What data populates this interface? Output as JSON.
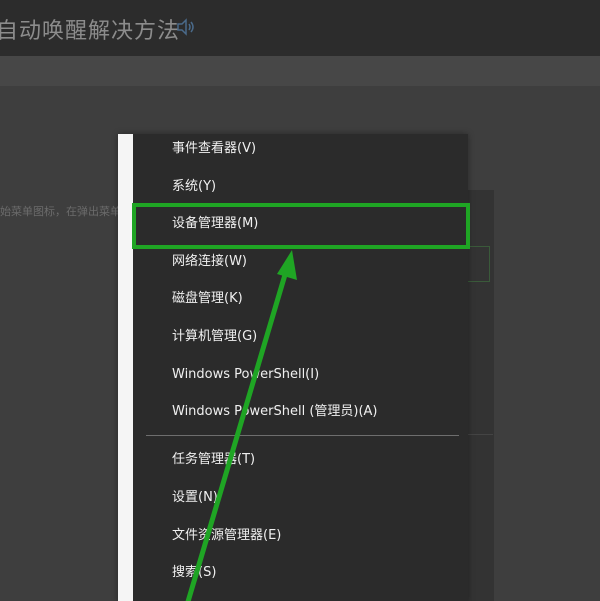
{
  "article": {
    "title_partial": "自动唤醒解决方法",
    "sound_icon": "speaker-icon",
    "tag_text": "",
    "body_text_partial": "始菜单图标，在弹出菜单中"
  },
  "context_menu": {
    "items": [
      {
        "label": "事件查看器(V)"
      },
      {
        "label": "系统(Y)"
      },
      {
        "label": "设备管理器(M)"
      },
      {
        "label": "网络连接(W)"
      },
      {
        "label": "磁盘管理(K)"
      },
      {
        "label": "计算机管理(G)"
      },
      {
        "label": "Windows PowerShell(I)"
      },
      {
        "label": "Windows PowerShell (管理员)(A)"
      },
      {
        "label": "任务管理器(T)"
      },
      {
        "label": "设置(N)"
      },
      {
        "label": "文件资源管理器(E)"
      },
      {
        "label": "搜索(S)"
      }
    ],
    "highlighted_item": "设备管理器(M)"
  },
  "annotation": {
    "color": "#1fa524",
    "type": "arrow-pointing-to-highlighted-item"
  }
}
